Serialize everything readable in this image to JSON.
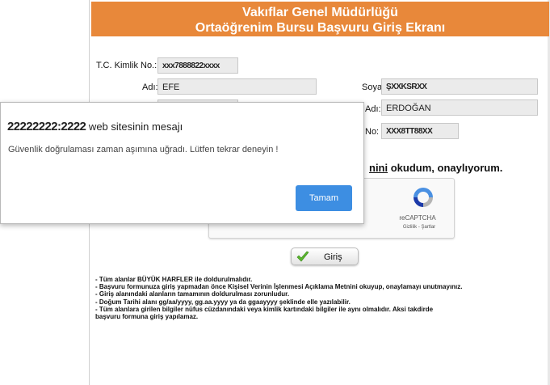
{
  "header": {
    "line1": "Vakıflar Genel Müdürlüğü",
    "line2": "Ortaöğrenim Bursu Başvuru Giriş Ekranı"
  },
  "form": {
    "tc_label": "T.C. Kimlik No.:",
    "tc_value": "xxx7888822xxxx",
    "ad_label": "Adı:",
    "ad_value": "EFE",
    "soyad_label": "Soyadı:",
    "soyad_value": "ŞXXKSRXX",
    "ana_adi_label": "Adı:",
    "ana_adi_value": "ERDOĞAN",
    "no_label": "No:",
    "no_value": "XXX8TT88XX"
  },
  "agreement": {
    "tail_underlined": "nini",
    "tail_rest": " okudum, onaylıyorum."
  },
  "captcha": {
    "title": "reCAPTCHA",
    "links": "Gizlilik - Şartlar"
  },
  "giris_button": {
    "label": "Giriş"
  },
  "notes": [
    "- Tüm alanlar BÜYÜK HARFLER ile doldurulmalıdır.",
    "- Başvuru formunuza giriş yapmadan önce Kişisel Verinin İşlenmesi Açıklama Metnini okuyup, onaylamayı unutmayınız.",
    "- Giriş alanındaki alanların tamamının doldurulması zorunludur.",
    "- Doğum Tarihi alanı gg/aa/yyyy, gg.aa.yyyy ya da ggaayyyy şeklinde elle yazılabilir.",
    "- Tüm alanlara girilen bilgiler nüfus cüzdanındaki veya kimlik kartındaki bilgiler ile aynı olmalıdır. Aksi takdirde",
    "başvuru formuna giriş yapılamaz."
  ],
  "dialog": {
    "host": "22222222:2222",
    "title_suffix": " web sitesinin mesajı",
    "message": "Güvenlik doğrulaması zaman aşımına uğradı. Lütfen tekrar deneyin !",
    "ok_label": "Tamam"
  },
  "colors": {
    "header_bg": "#e8883a",
    "dialog_button": "#3d8ee2"
  }
}
